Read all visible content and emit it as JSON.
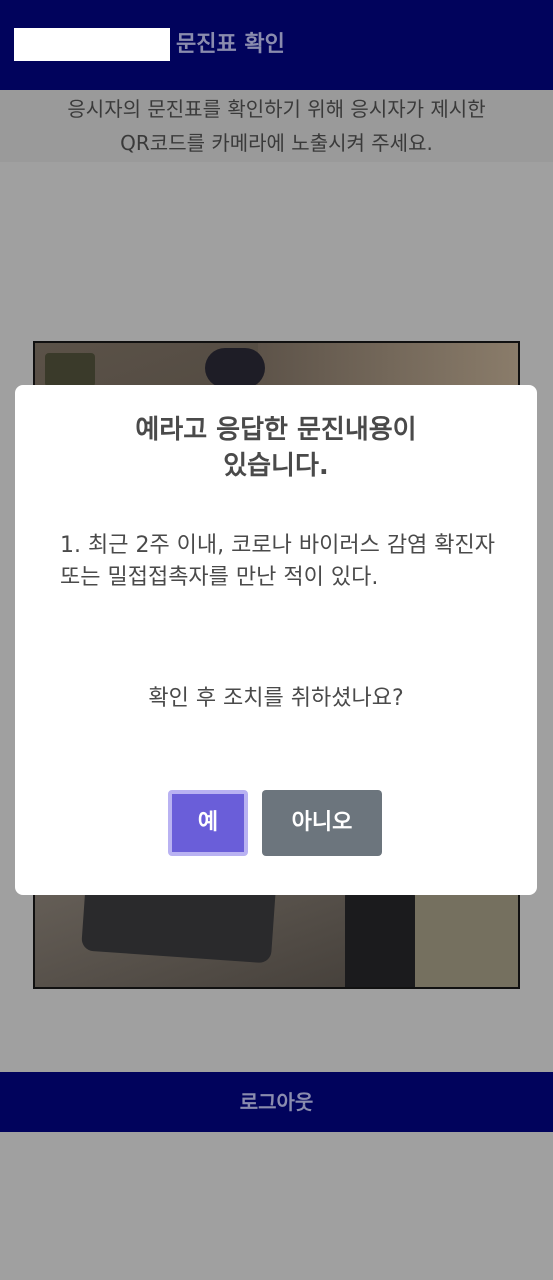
{
  "header": {
    "title": "문진표 확인"
  },
  "instruction": {
    "line1": "응시자의 문진표를 확인하기 위해 응시자가 제시한",
    "line2": "QR코드를 카메라에 노출시켜 주세요."
  },
  "modal": {
    "title_line1": "예라고 응답한 문진내용이",
    "title_line2": "있습니다.",
    "item": "1. 최근 2주 이내, 코로나 바이러스 감염 확진자 또는 밀접접촉자를 만난 적이 있다.",
    "question": "확인 후 조치를 취하셨나요?",
    "yes_label": "예",
    "no_label": "아니오"
  },
  "footer": {
    "logout_label": "로그아웃"
  },
  "colors": {
    "header_bg": "#01035c",
    "yes_button": "#6a5ed9",
    "no_button": "#6c757d"
  }
}
